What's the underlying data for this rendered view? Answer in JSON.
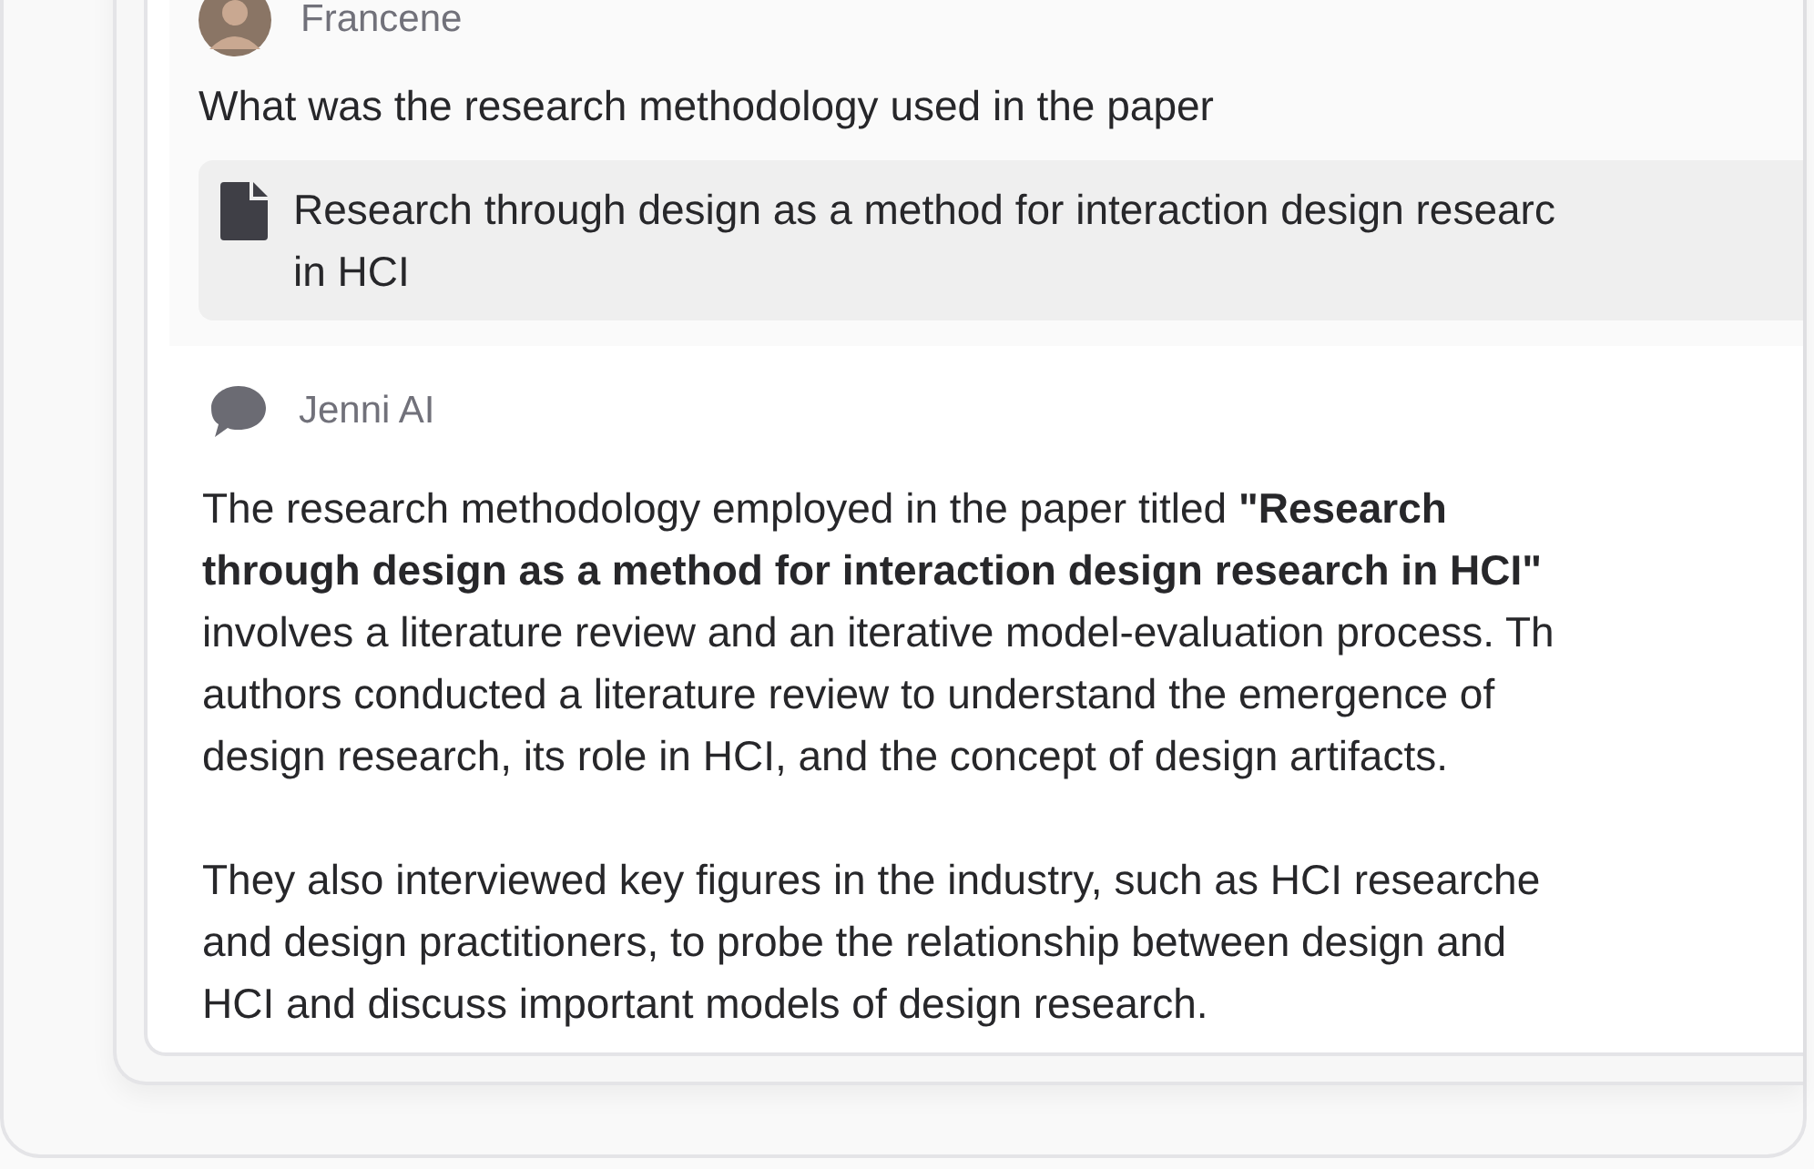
{
  "user_message": {
    "author": "Francene",
    "text": "What was the research methodology used in the paper",
    "attachment_lines": [
      "Research through design as a method for interaction design researc",
      "in HCI"
    ]
  },
  "ai_message": {
    "author": "Jenni AI",
    "paragraphs": [
      [
        "The research methodology employed in the paper titled **\"Research**",
        "**through design as a method for interaction design research in HCI\"**",
        "involves a literature review and an iterative model-evaluation process. Th",
        "authors conducted a literature review to understand the emergence of",
        "design research, its role in HCI, and the concept of design artifacts."
      ],
      [
        "They also interviewed key figures in the industry, such as HCI researche",
        "and design practitioners, to probe the relationship between design and",
        "HCI and discuss important models of design research."
      ]
    ]
  }
}
